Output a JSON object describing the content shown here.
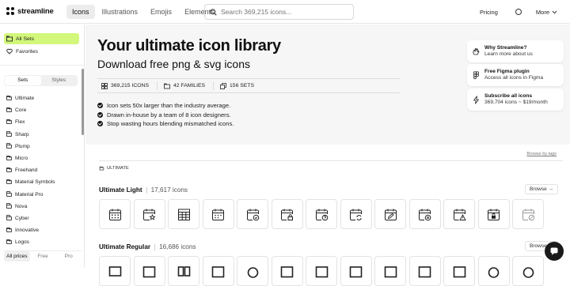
{
  "header": {
    "brand": "streamline",
    "tabs": [
      {
        "label": "Icons",
        "active": true
      },
      {
        "label": "Illustrations",
        "active": false
      },
      {
        "label": "Emojis",
        "active": false
      },
      {
        "label": "Elements",
        "active": false
      }
    ],
    "search_placeholder": "Search 369,215 icons...",
    "pricing": "Pricing",
    "more": "More"
  },
  "sidebar": {
    "all_sets": "All Sets",
    "favorites": "Favorites",
    "segment": {
      "sets": "Sets",
      "styles": "Styles"
    },
    "categories": [
      "Ultimate",
      "Core",
      "Flex",
      "Sharp",
      "Plump",
      "Micro",
      "Freehand",
      "Material Symbols",
      "Material Pro",
      "Nova",
      "Cyber",
      "Innovative",
      "Logos"
    ],
    "price_filter": {
      "all": "All prices",
      "free": "Free",
      "pro": "Pro"
    }
  },
  "hero": {
    "title": "Your ultimate icon library",
    "subtitle": "Download free png & svg icons",
    "stats": {
      "icons": "369,215 ICONS",
      "families": "42 FAMILIES",
      "sets": "156 SETS"
    },
    "bullets": [
      "Icon sets 50x larger than the industry average.",
      "Drawn in-house by a team of 8 icon designers.",
      "Stop wasting hours blending mismatched icons."
    ],
    "cards": [
      {
        "title": "Why Streamline?",
        "sub": "Learn more about us"
      },
      {
        "title": "Free Figma plugin",
        "sub": "Access all icons in Figma"
      },
      {
        "title": "Subscribe all icons",
        "sub": "369,704 icons ~ $19/month"
      }
    ]
  },
  "content": {
    "browse_by_tags": "Browse by tags",
    "section_label": "ULTIMATE",
    "sets": [
      {
        "name": "Ultimate Light",
        "count": "17,617 icons",
        "browse": "Browse →"
      },
      {
        "name": "Ultimate Regular",
        "count": "16,686 icons",
        "browse": "Browse →"
      }
    ]
  },
  "colors": {
    "accent": "#d2f77a",
    "hero_bg": "#f6f6f6"
  }
}
